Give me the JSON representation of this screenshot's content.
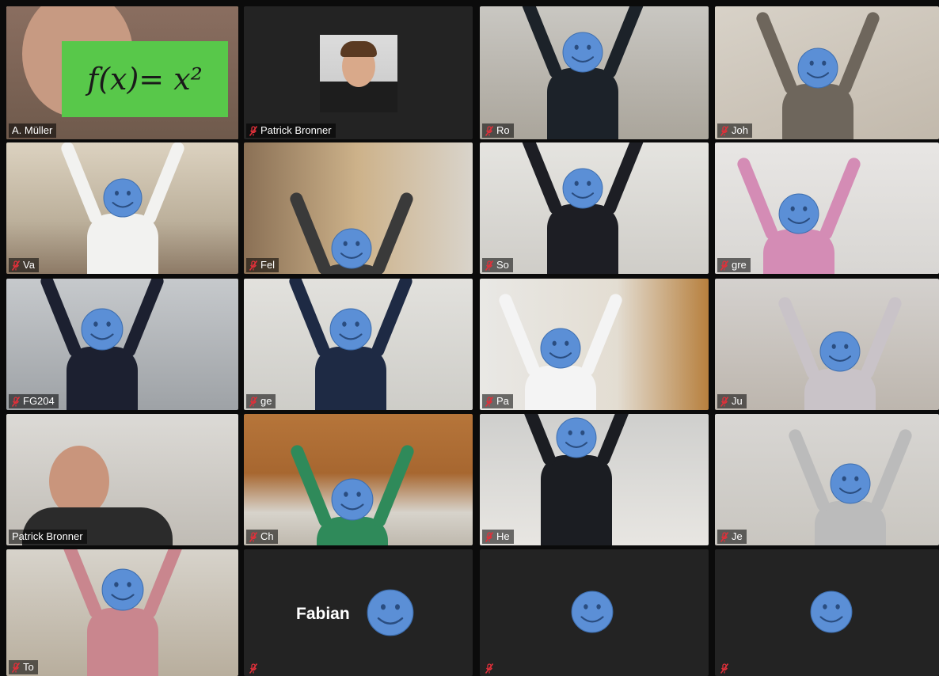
{
  "meeting": {
    "participants": [
      {
        "name": "A. Müller",
        "muted": false,
        "active": true,
        "sign_text": "f(x)= x²"
      },
      {
        "name": "Patrick Bronner",
        "muted": true
      },
      {
        "name": "Ro",
        "muted": true
      },
      {
        "name": "Joh",
        "muted": true
      },
      {
        "name": "Va",
        "muted": true
      },
      {
        "name": "Fel",
        "muted": true
      },
      {
        "name": "So",
        "muted": true
      },
      {
        "name": "gre",
        "muted": true
      },
      {
        "name": "FG204",
        "muted": true
      },
      {
        "name": "ge",
        "muted": true
      },
      {
        "name": "Pa",
        "muted": true
      },
      {
        "name": "Ju",
        "muted": true
      },
      {
        "name": "Patrick Bronner",
        "muted": false
      },
      {
        "name": "Ch",
        "muted": true
      },
      {
        "name": "He",
        "muted": true
      },
      {
        "name": "Je",
        "muted": true
      },
      {
        "name": "To",
        "muted": true
      },
      {
        "name": "",
        "muted": true,
        "center_name": "Fabian"
      },
      {
        "name": "",
        "muted": true
      },
      {
        "name": "",
        "muted": true
      }
    ]
  },
  "colors": {
    "active_border": "#e6ef8a",
    "smiley_fill": "#5b8fd6",
    "mute_icon": "#e0303a",
    "tile_empty": "#232323"
  }
}
